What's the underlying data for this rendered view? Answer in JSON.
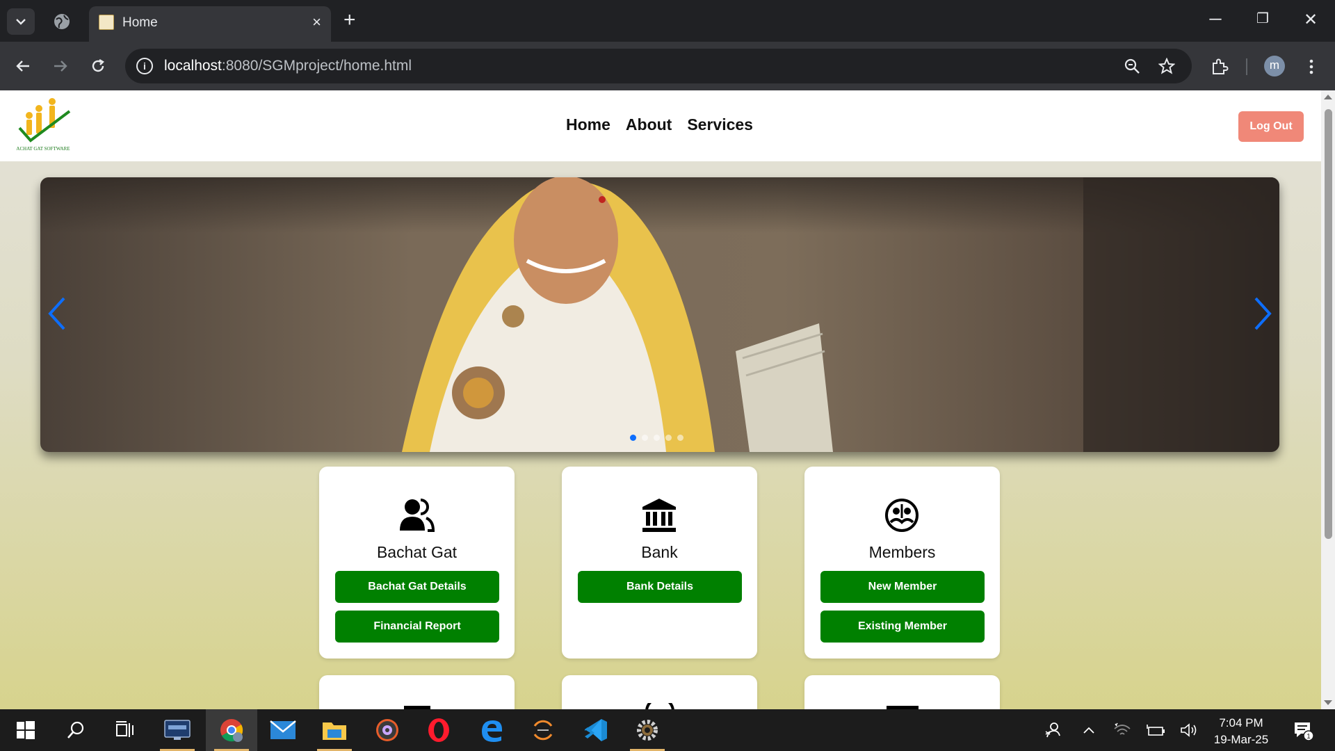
{
  "browser": {
    "tab_title": "Home",
    "tab_close": "×",
    "new_tab": "+",
    "url_host": "localhost",
    "url_path": ":8080/SGMproject/home.html",
    "info_icon": "i",
    "profile_initial": "m",
    "window_controls": {
      "minimize": "─",
      "restore": "❐",
      "close": "✕"
    }
  },
  "site": {
    "logo_text": "ACHAT GAT SOFTWARE",
    "nav": [
      "Home",
      "About",
      "Services"
    ],
    "logout_label": "Log Out"
  },
  "carousel": {
    "slide_count": 5,
    "active_index": 0,
    "arrow_color": "#0d6efd"
  },
  "cards": [
    {
      "title": "Bachat Gat",
      "icon": "users-icon",
      "buttons": [
        "Bachat Gat Details",
        "Financial Report"
      ]
    },
    {
      "title": "Bank",
      "icon": "bank-icon",
      "buttons": [
        "Bank Details"
      ]
    },
    {
      "title": "Members",
      "icon": "members-icon",
      "buttons": [
        "New Member",
        "Existing Member"
      ]
    }
  ],
  "colors": {
    "primary_button": "#008000",
    "logout_button": "#f08878",
    "accent": "#0d6efd"
  },
  "taskbar": {
    "apps": [
      "start-icon",
      "search-icon",
      "task-view-icon",
      "mysql-icon",
      "chrome-icon",
      "mail-icon",
      "file-explorer-icon",
      "media-icon",
      "opera-icon",
      "edge-icon",
      "eclipse-icon",
      "vscode-icon",
      "settings-gear-icon"
    ],
    "clock_time": "7:04 PM",
    "clock_date": "19-Mar-25",
    "notification_count": "1"
  }
}
